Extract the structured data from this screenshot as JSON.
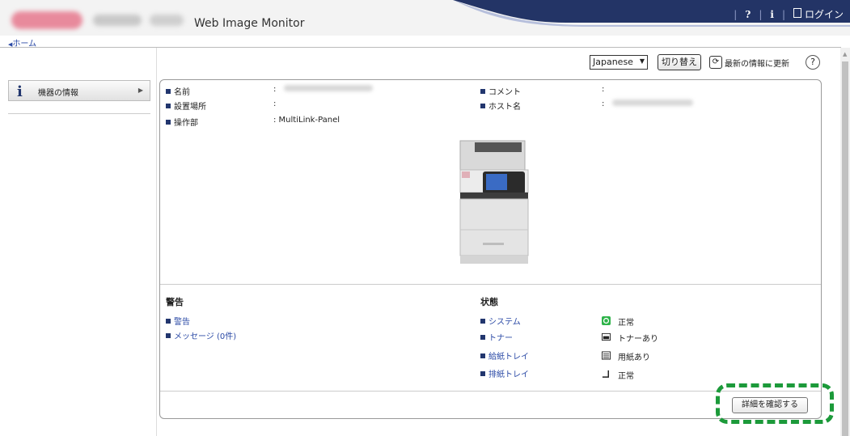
{
  "header": {
    "app_title": "Web Image Monitor",
    "nav": {
      "help_label": "?",
      "info_label": "i",
      "login_label": "ログイン"
    },
    "brand_colors": {
      "navy": "#233466",
      "accent_green": "#1c9a3a"
    }
  },
  "breadcrumb": {
    "home_label": "ホーム"
  },
  "sidebar": {
    "items": [
      {
        "label": "機器の情報",
        "icon": "info-icon"
      }
    ]
  },
  "toolbar": {
    "language_selected": "Japanese",
    "switch_label": "切り替え",
    "refresh_label": "最新の情報に更新",
    "help_label": "?"
  },
  "device_info": {
    "name_label": "名前",
    "name_value": ":",
    "location_label": "設置場所",
    "location_value": ":",
    "panel_label": "操作部",
    "panel_value": ": MultiLink-Panel",
    "comment_label": "コメント",
    "comment_value": ":",
    "host_label": "ホスト名",
    "host_value": ":"
  },
  "alerts": {
    "title": "警告",
    "items": [
      "警告",
      "メッセージ (0件)"
    ]
  },
  "status": {
    "title": "状態",
    "items": [
      {
        "label": "システム",
        "value": "正常",
        "icon": "system-ok-icon"
      },
      {
        "label": "トナー",
        "value": "トナーあり",
        "icon": "toner-icon"
      },
      {
        "label": "給紙トレイ",
        "value": "用紙あり",
        "icon": "paper-tray-icon"
      },
      {
        "label": "排紙トレイ",
        "value": "正常",
        "icon": "output-tray-icon"
      }
    ]
  },
  "detail_button_label": "詳細を確認する"
}
